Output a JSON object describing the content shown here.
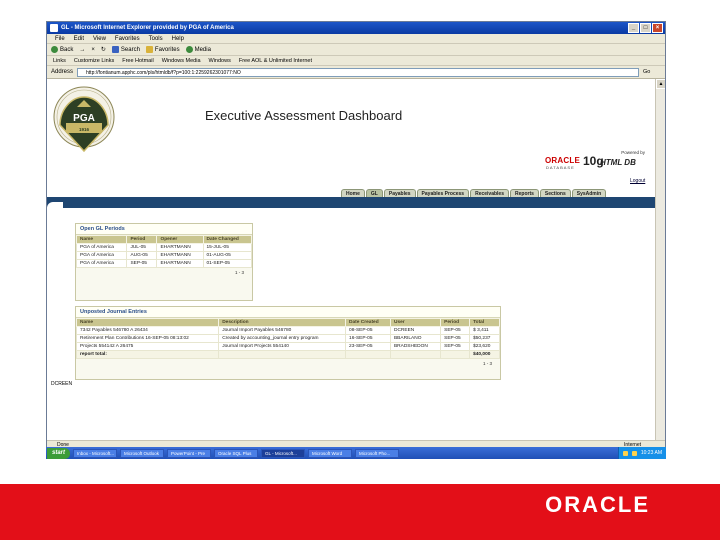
{
  "browser": {
    "title": "GL - Microsoft Internet Explorer provided by PGA of America",
    "menu": [
      "File",
      "Edit",
      "View",
      "Favorites",
      "Tools",
      "Help"
    ],
    "toolbar": [
      "Back",
      "→",
      "×",
      "↻",
      "Search",
      "Favorites",
      "Media"
    ],
    "links_label": "Links",
    "links": [
      "Customize Links",
      "Free Hotmail",
      "Windows Media",
      "Windows",
      "Free AOL & Unlimited Internet"
    ],
    "address_label": "Address",
    "address": "http://fontianum.apphc.com/pls/htmldb/f?p=100:1:2259262301077:NO",
    "go_label": "Go",
    "status_left": "Done",
    "status_right": "Internet"
  },
  "app": {
    "logo_text": "PGA",
    "logo_ring": "PROFESSIONAL GOLFERS' ASSOCIATION OF AMERICA",
    "logo_year": "1916",
    "title": "Executive Assessment Dashboard",
    "powered_by": "Powered by",
    "oracle_word": "ORACLE",
    "database_word": "DATABASE",
    "tenG": "10g",
    "htmldb": "HTML DB",
    "logout": "Logout",
    "user": "DCREEN"
  },
  "tabs": [
    {
      "label": "Home",
      "active": false
    },
    {
      "label": "GL",
      "active": true
    },
    {
      "label": "Payables",
      "active": false
    },
    {
      "label": "Payables Process",
      "active": false
    },
    {
      "label": "Receivables",
      "active": false
    },
    {
      "label": "Reports",
      "active": false
    },
    {
      "label": "Sections",
      "active": false
    },
    {
      "label": "SysAdmin",
      "active": false
    }
  ],
  "open_gl": {
    "header": "Open GL Periods",
    "columns": [
      "Name",
      "Period",
      "Opener",
      "Date Changed"
    ],
    "rows": [
      [
        "PGA of America",
        "JUL-05",
        "EHARTMANN",
        "15-JUL-05"
      ],
      [
        "PGA of America",
        "AUG-05",
        "EHARTMANN",
        "01-AUG-05"
      ],
      [
        "PGA of America",
        "SEP-05",
        "EHARTMANN",
        "01-SEP-05"
      ]
    ],
    "pager": "1 - 3"
  },
  "unposted": {
    "header": "Unposted Journal Entries",
    "columns": [
      "Name",
      "Description",
      "Date Created",
      "User",
      "Period",
      "Total"
    ],
    "rows": [
      [
        "7342 Payables 546780 A 26434",
        "Journal Import Payables 546780",
        "08-SEP-05",
        "DCREEN",
        "SEP-05",
        "$ 3,411"
      ],
      [
        "Retirement Plan Contributions 16-SEP-05 08:13:02",
        "Created by accounting_journal entry program",
        "16-SEP-05",
        "BBARILANO",
        "SEP-05",
        "$50,237"
      ],
      [
        "Projects 554142 A 26475",
        "Journal Import Projects 554140",
        "23-SEP-05",
        "BRADSHEDON",
        "SEP-05",
        "$23,620"
      ]
    ],
    "total_label": "report total:",
    "total_value": "$40,000",
    "pager": "1 - 3"
  },
  "taskbar": {
    "start": "start",
    "tasks": [
      "Inbox - Microsoft...",
      "Microsoft Outlook",
      "PowerPoint - Pre",
      "Oracle SQL Plus",
      "GL - Microsoft...",
      "Microsoft Word",
      "Microsoft Pho..."
    ],
    "active_index": 4,
    "clock": "10:23 AM"
  },
  "slide": {
    "logo": "ORACLE"
  },
  "colors": {
    "brand_red": "#e30f18",
    "nav_blue": "#1e4672",
    "table_header": "#c9c58f"
  }
}
